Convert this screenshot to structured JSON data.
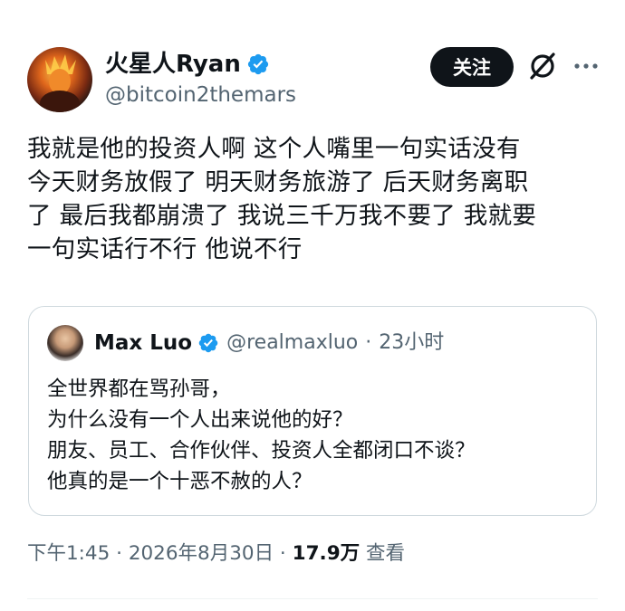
{
  "tweet": {
    "author": {
      "display_name": "火星人Ryan",
      "handle": "@bitcoin2themars",
      "verified_icon": "verified-badge-icon"
    },
    "follow_label": "关注",
    "text": "我就是他的投资人啊 这个人嘴里一句实话没有\n今天财务放假了 明天财务旅游了 后天财务离职\n了 最后我都崩溃了 我说三千万我不要了 我就要\n一句实话行不行 他说不行",
    "quote": {
      "display_name": "Max Luo",
      "handle": "@realmaxluo",
      "sep": "·",
      "time": "23小时",
      "text": "全世界都在骂孙哥，\n为什么没有一个人出来说他的好？\n朋友、员工、合作伙伴、投资人全都闭口不谈？\n他真的是一个十恶不赦的人？"
    },
    "meta": {
      "time": "下午1:45",
      "sep1": "·",
      "date": "2026年8月30日",
      "sep2": "·",
      "views_count": "17.9万",
      "views_label": "查看"
    }
  },
  "colors": {
    "verified": "#1d9bf0",
    "text_primary": "#0f1419",
    "text_secondary": "#536471",
    "border": "#cfd9de"
  },
  "icons": [
    "grok-icon",
    "more-options-icon",
    "verified-badge-icon"
  ]
}
